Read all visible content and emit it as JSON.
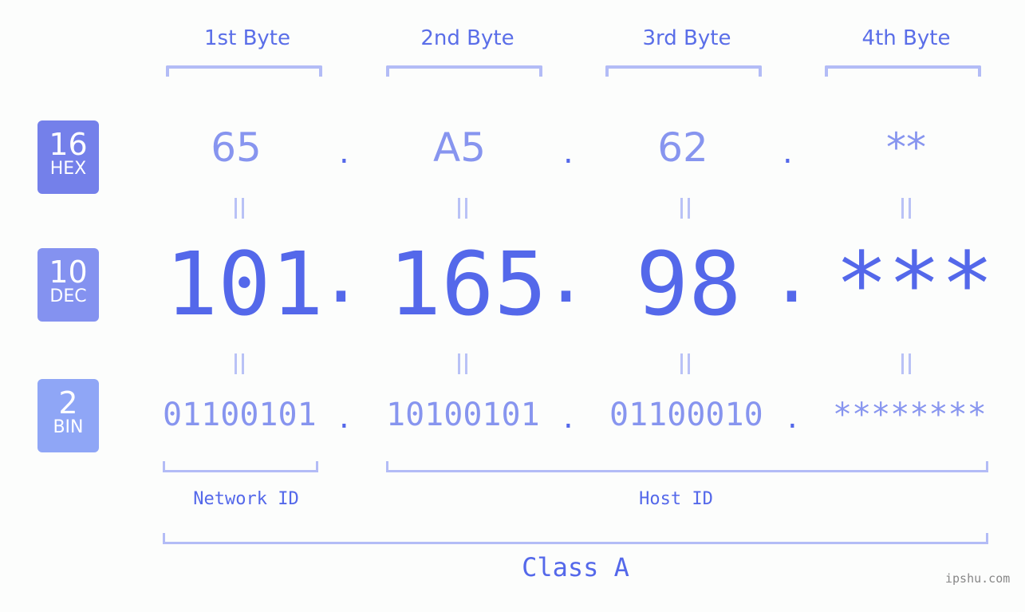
{
  "bytes": [
    {
      "label": "1st Byte",
      "hex": "65",
      "dec": "101",
      "bin": "01100101"
    },
    {
      "label": "2nd Byte",
      "hex": "A5",
      "dec": "165",
      "bin": "10100101"
    },
    {
      "label": "3rd Byte",
      "hex": "62",
      "dec": "98",
      "bin": "01100010"
    },
    {
      "label": "4th Byte",
      "hex": "**",
      "dec": "***",
      "bin": "********"
    }
  ],
  "separator": ".",
  "badges": {
    "hex": {
      "base": "16",
      "name": "HEX",
      "color": "#7480ea"
    },
    "dec": {
      "base": "10",
      "name": "DEC",
      "color": "#8492f0"
    },
    "bin": {
      "base": "2",
      "name": "BIN",
      "color": "#8fa6f6"
    }
  },
  "segments": {
    "network": "Network ID",
    "host": "Host ID",
    "class": "Class A"
  },
  "watermark": "ipshu.com"
}
